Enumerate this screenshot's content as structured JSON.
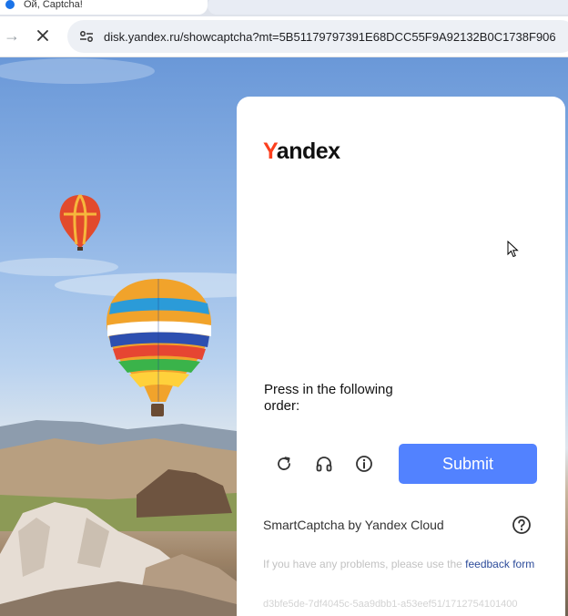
{
  "browser": {
    "tab_title": "Ой, Captcha!",
    "url": "disk.yandex.ru/showcaptcha?mt=5B51179797391E68DCC55F9A92132B0C1738F906"
  },
  "captcha": {
    "logo_first": "Y",
    "logo_rest": "andex",
    "instruction": "Press in the following order:",
    "submit_label": "Submit",
    "brand_text": "SmartCaptcha by Yandex Cloud",
    "problems_text": "If you have any problems, please use the",
    "feedback_link": "feedback form",
    "hash_text": "d3bfe5de-7df4045c-5aa9dbb1-a53eef51/1712754101400"
  },
  "icons": {
    "site_info": "tune-icon",
    "forward": "arrow-right-icon",
    "stop": "close-icon",
    "reload": "reload-icon",
    "audio": "headphones-icon",
    "info": "info-icon",
    "help": "question-icon"
  },
  "colors": {
    "submit_bg": "#5282ff",
    "brand_red": "#fc3f1d",
    "link": "#2c4b9a"
  }
}
